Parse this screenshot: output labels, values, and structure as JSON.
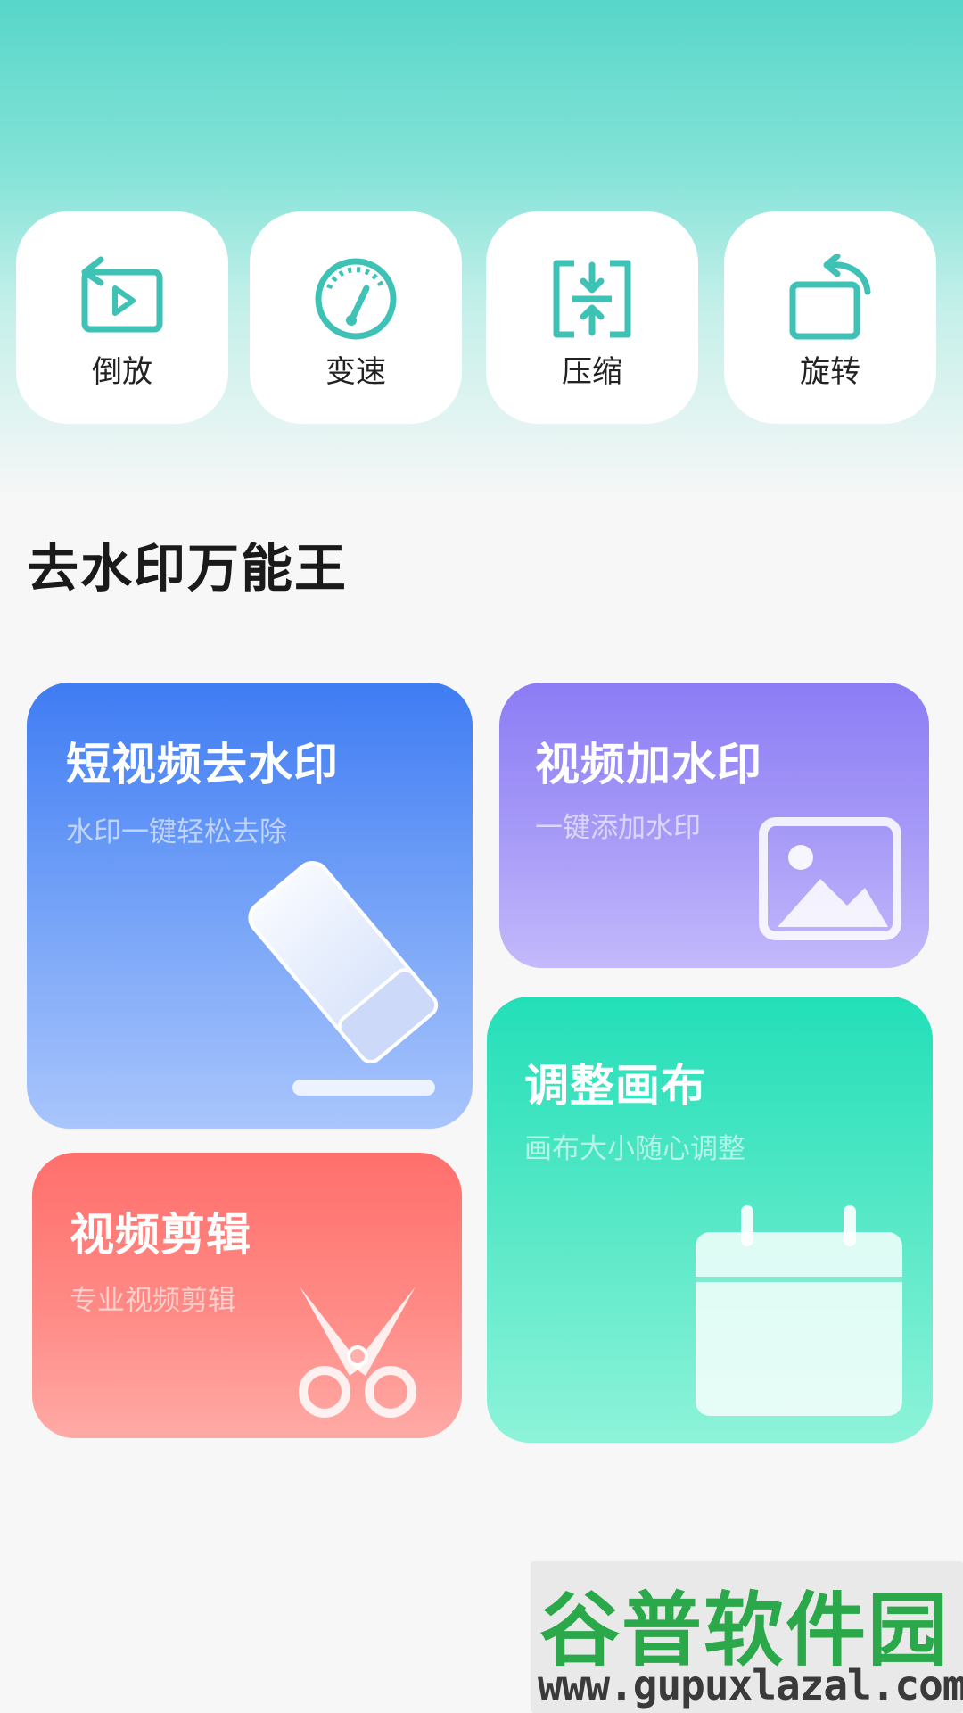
{
  "tools": [
    {
      "label": "倒放",
      "icon": "reverse-play-icon"
    },
    {
      "label": "变速",
      "icon": "speedometer-icon"
    },
    {
      "label": "压缩",
      "icon": "compress-icon"
    },
    {
      "label": "旋转",
      "icon": "rotate-icon"
    }
  ],
  "section": {
    "title": "去水印万能王"
  },
  "cards": {
    "remove_watermark": {
      "title": "短视频去水印",
      "subtitle": "水印一键轻松去除",
      "icon": "eraser-icon"
    },
    "add_watermark": {
      "title": "视频加水印",
      "subtitle": "一键添加水印",
      "icon": "image-icon"
    },
    "video_edit": {
      "title": "视频剪辑",
      "subtitle": "专业视频剪辑",
      "icon": "scissors-icon"
    },
    "adjust_canvas": {
      "title": "调整画布",
      "subtitle": "画布大小随心调整",
      "icon": "calendar-icon"
    }
  },
  "watermark": {
    "name": "谷普软件园",
    "url": "www.gupuxlazal.com"
  },
  "colors": {
    "accent": "#3fc2b6",
    "blue_card": "#3f7cf3",
    "purple_card": "#8c7cf5",
    "red_card": "#ff6f6c",
    "green_card": "#22dfb8"
  }
}
